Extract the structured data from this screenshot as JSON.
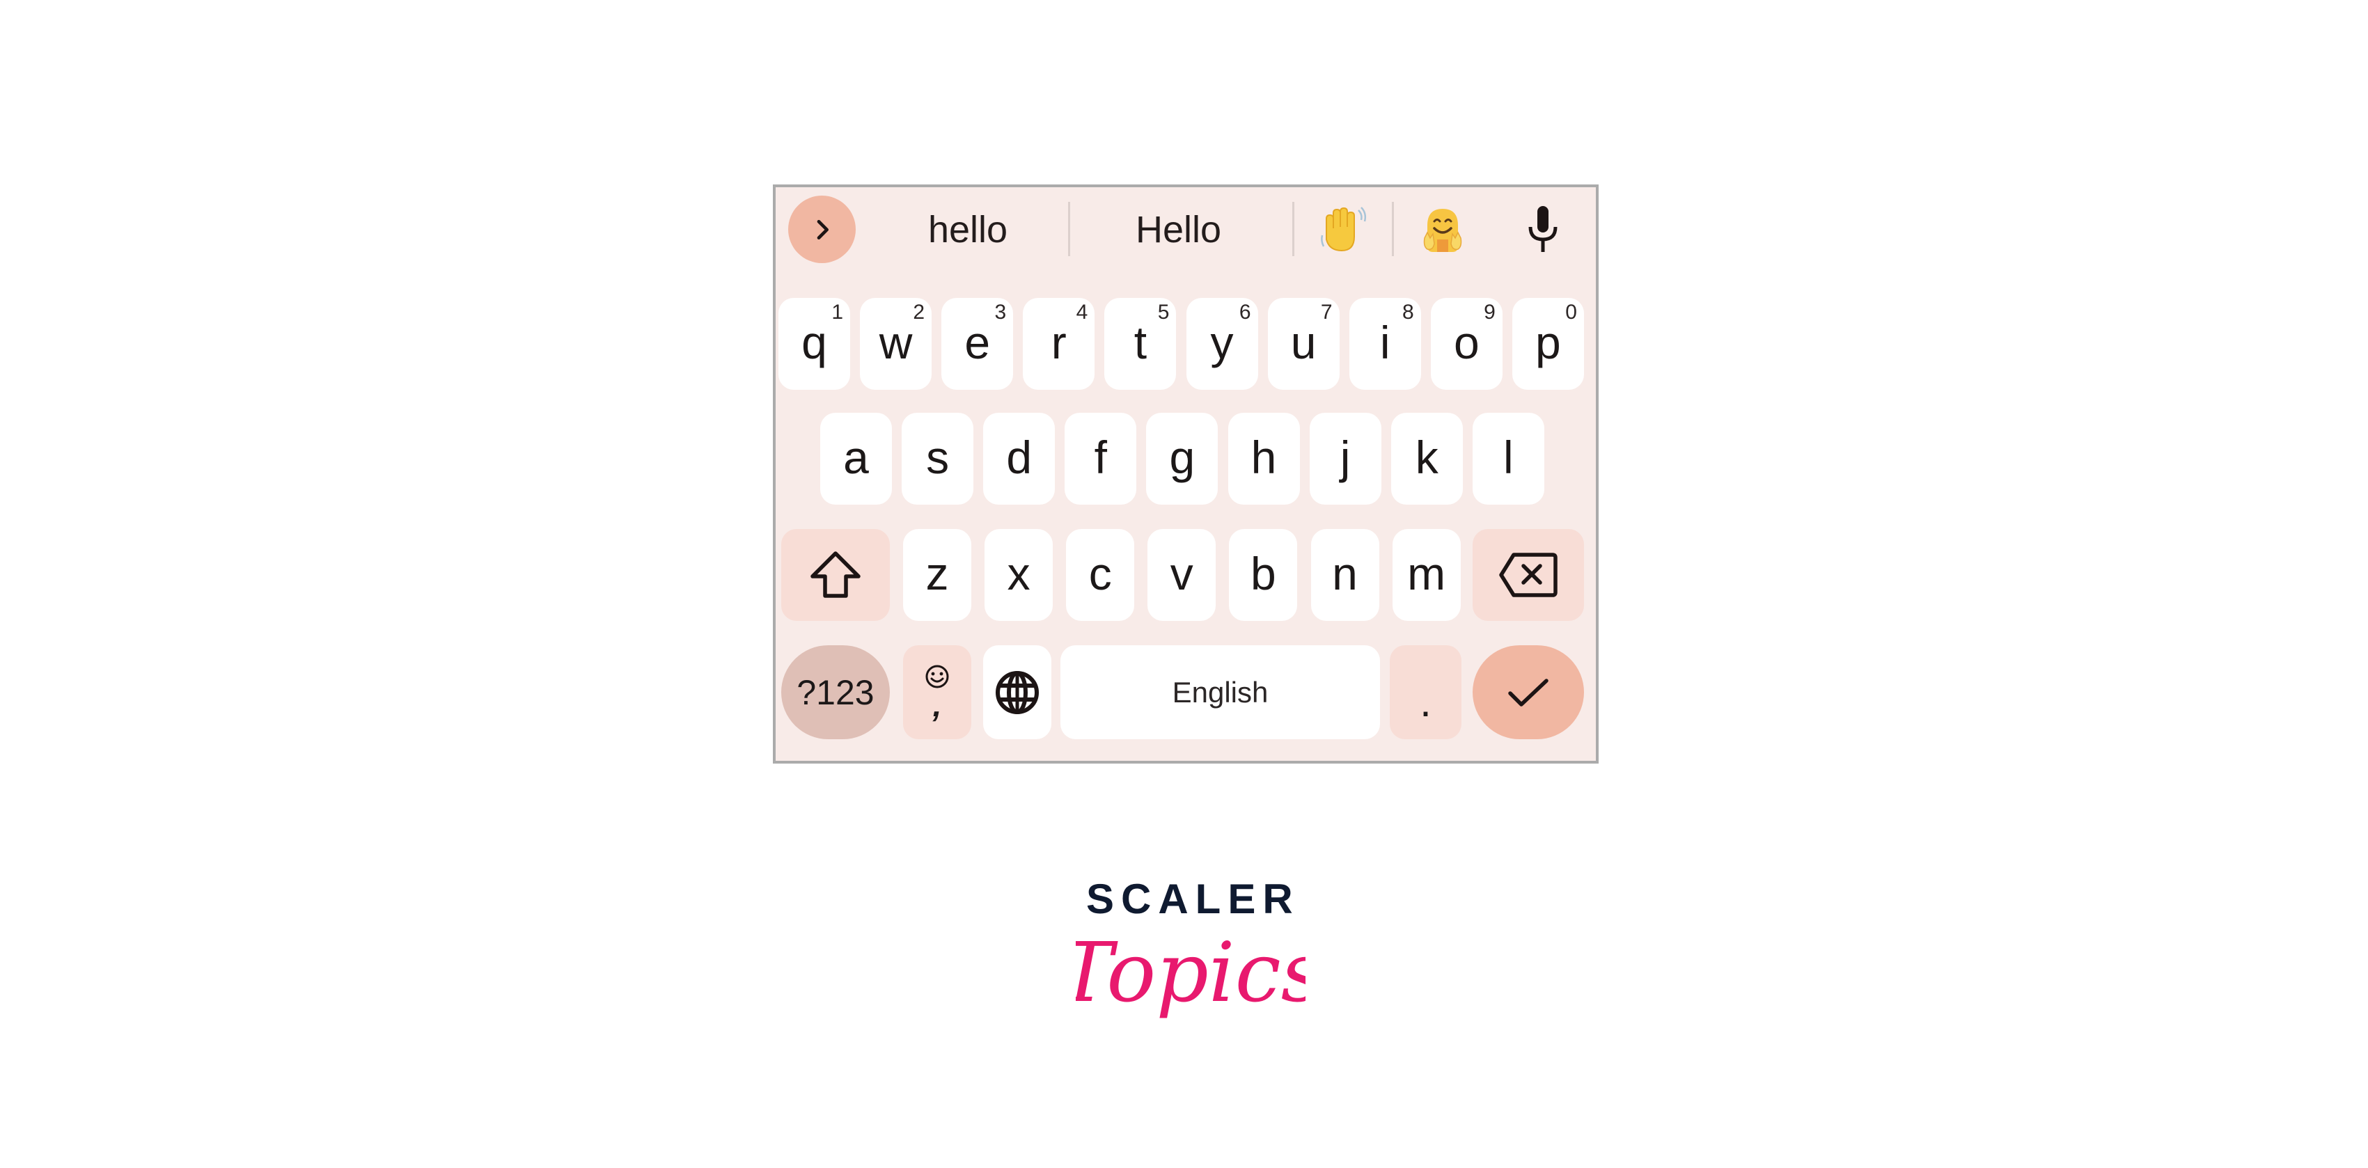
{
  "keyboard": {
    "suggestion_strip": {
      "expand_icon": "chevron-right-icon",
      "suggestions": [
        "hello",
        "Hello"
      ],
      "emoji_suggestions": [
        {
          "name": "waving-hand",
          "glyph": "👋"
        },
        {
          "name": "hugging-face",
          "glyph": "🤗"
        }
      ],
      "voice_icon": "microphone-icon"
    },
    "rows": [
      [
        {
          "label": "q",
          "hint": "1"
        },
        {
          "label": "w",
          "hint": "2"
        },
        {
          "label": "e",
          "hint": "3"
        },
        {
          "label": "r",
          "hint": "4"
        },
        {
          "label": "t",
          "hint": "5"
        },
        {
          "label": "y",
          "hint": "6"
        },
        {
          "label": "u",
          "hint": "7"
        },
        {
          "label": "i",
          "hint": "8"
        },
        {
          "label": "o",
          "hint": "9"
        },
        {
          "label": "p",
          "hint": "0"
        }
      ],
      [
        {
          "label": "a"
        },
        {
          "label": "s"
        },
        {
          "label": "d"
        },
        {
          "label": "f"
        },
        {
          "label": "g"
        },
        {
          "label": "h"
        },
        {
          "label": "j"
        },
        {
          "label": "k"
        },
        {
          "label": "l"
        }
      ],
      [
        {
          "label": "z"
        },
        {
          "label": "x"
        },
        {
          "label": "c"
        },
        {
          "label": "v"
        },
        {
          "label": "b"
        },
        {
          "label": "n"
        },
        {
          "label": "m"
        }
      ]
    ],
    "shift_icon": "shift-arrow-icon",
    "backspace_icon": "backspace-icon",
    "symbols_label": "?123",
    "emoji_comma": {
      "icon": "smiley-icon",
      "label": ","
    },
    "language_icon": "globe-icon",
    "space_label": "English",
    "period_label": ".",
    "enter_icon": "checkmark-icon",
    "colors": {
      "background": "#F8EBE8",
      "key": "#FFFFFF",
      "modifier_key": "#F8DDD6",
      "symbols_key": "#DFBFB6",
      "accent": "#F1B7A2",
      "border": "#ABABAB"
    }
  },
  "logo": {
    "line1": "SCALER",
    "line2": "Topics",
    "colors": {
      "line1": "#0F1A30",
      "line2": "#E8196E"
    }
  }
}
